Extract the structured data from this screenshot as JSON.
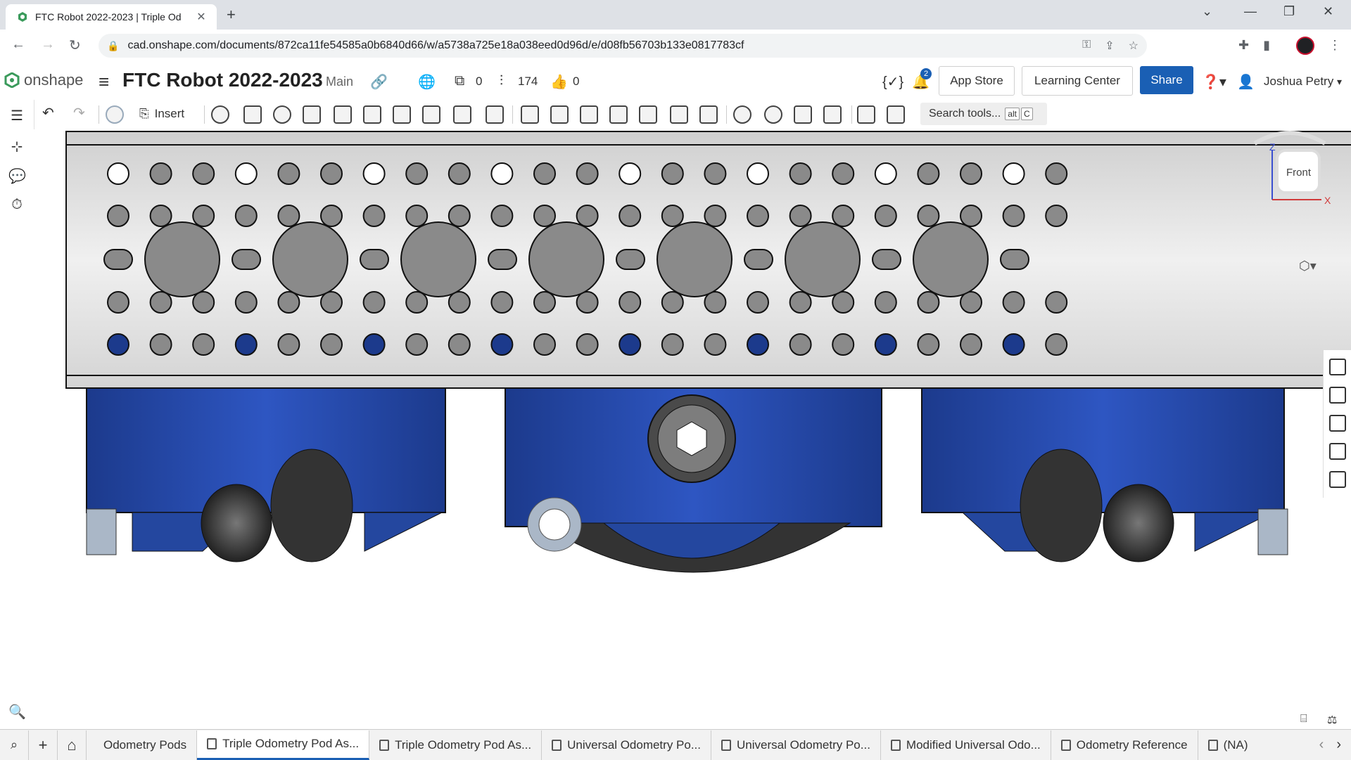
{
  "browser": {
    "tab_title": "FTC Robot 2022-2023 | Triple Od",
    "url": "cad.onshape.com/documents/872ca11fe54585a0b6840d66/w/a5738a725e18a038eed0d96d/e/d08fb56703b133e0817783cf"
  },
  "header": {
    "brand": "onshape",
    "doc_title": "FTC Robot 2022-2023",
    "branch": "Main",
    "versions_count": "0",
    "history_count": "174",
    "likes_count": "0",
    "notif_count": "2",
    "app_store": "App Store",
    "learning_center": "Learning Center",
    "share": "Share",
    "user_name": "Joshua Petry"
  },
  "toolbar": {
    "insert": "Insert",
    "search_placeholder": "Search tools...",
    "shortcut_key1": "alt",
    "shortcut_key2": "C"
  },
  "viewcube": {
    "face": "Front",
    "axis_z": "Z",
    "axis_x": "X"
  },
  "bottom_tabs": [
    {
      "label": "Odometry Pods"
    },
    {
      "label": "Triple Odometry Pod As..."
    },
    {
      "label": "Triple Odometry Pod As..."
    },
    {
      "label": "Universal Odometry Po..."
    },
    {
      "label": "Universal Odometry Po..."
    },
    {
      "label": "Modified Universal Odo..."
    },
    {
      "label": "Odometry Reference"
    },
    {
      "label": "(NA)"
    }
  ]
}
